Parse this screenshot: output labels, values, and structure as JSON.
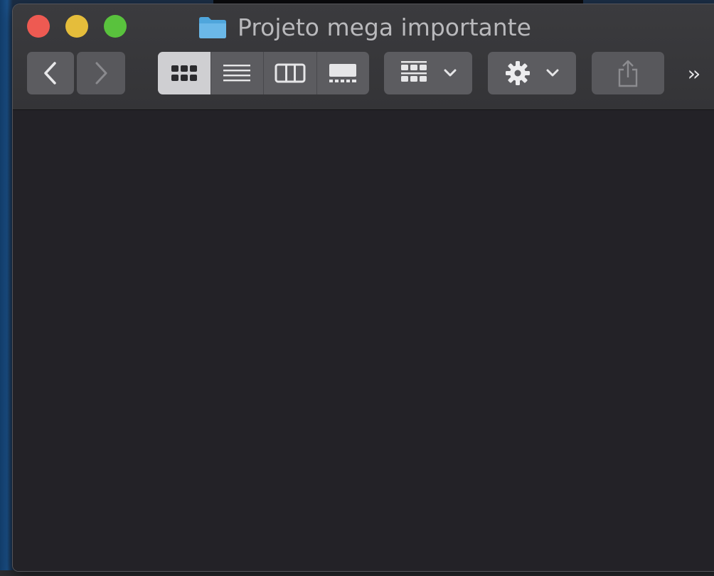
{
  "window": {
    "title": "Projeto mega importante"
  },
  "toolbar": {
    "back_icon": "chevron-left-icon",
    "forward_icon": "chevron-right-icon",
    "view_modes": [
      "icon-view",
      "list-view",
      "column-view",
      "gallery-view"
    ],
    "active_view": "icon-view",
    "group_icon": "group-grid-icon",
    "action_icon": "gear-icon",
    "share_icon": "share-icon",
    "more_label": "››"
  },
  "colors": {
    "close": "#ee5a52",
    "minimize": "#e5bd3b",
    "zoom": "#59c23d",
    "folder": "#6bb8e8",
    "window_bg": "#232227",
    "toolbar_button": "#5c5c60"
  }
}
